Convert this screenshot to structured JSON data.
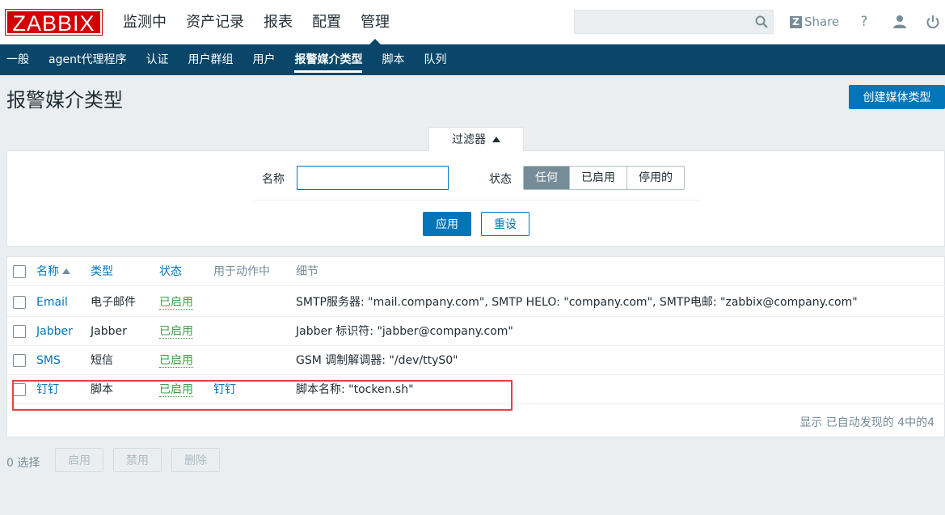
{
  "header": {
    "logo": "ZABBIX",
    "nav": [
      "监测中",
      "资产记录",
      "报表",
      "配置",
      "管理"
    ],
    "search_placeholder": "",
    "share_label": "Share",
    "share_badge": "Z",
    "help_label": "?"
  },
  "subnav": [
    "一般",
    "agent代理程序",
    "认证",
    "用户群组",
    "用户",
    "报警媒介类型",
    "脚本",
    "队列"
  ],
  "page": {
    "title": "报警媒介类型",
    "create_button": "创建媒体类型"
  },
  "filter": {
    "tab_label": "过滤器",
    "name_label": "名称",
    "name_value": "",
    "status_label": "状态",
    "status_options": [
      "任何",
      "已启用",
      "停用的"
    ],
    "status_selected": "任何",
    "apply_label": "应用",
    "reset_label": "重设"
  },
  "table": {
    "columns": [
      "名称",
      "类型",
      "状态",
      "用于动作中",
      "细节"
    ],
    "rows": [
      {
        "name": "Email",
        "type": "电子邮件",
        "status": "已启用",
        "action": "",
        "details": "SMTP服务器: \"mail.company.com\", SMTP HELO: \"company.com\", SMTP电邮: \"zabbix@company.com\""
      },
      {
        "name": "Jabber",
        "type": "Jabber",
        "status": "已启用",
        "action": "",
        "details": "Jabber 标识符: \"jabber@company.com\""
      },
      {
        "name": "SMS",
        "type": "短信",
        "status": "已启用",
        "action": "",
        "details": "GSM 调制解调器: \"/dev/ttyS0\""
      },
      {
        "name": "钉钉",
        "type": "脚本",
        "status": "已启用",
        "action": "钉钉",
        "details": "脚本名称: \"tocken.sh\""
      }
    ],
    "footer": "显示 已自动发现的 4中的4"
  },
  "bulk": {
    "selected": "0 选择",
    "enable": "启用",
    "disable": "禁用",
    "delete": "删除"
  },
  "colors": {
    "brand": "#d40000",
    "subnav_bg": "#0a466a",
    "primary": "#0275b8",
    "enabled": "#429e47",
    "highlight": "#e8413f"
  }
}
